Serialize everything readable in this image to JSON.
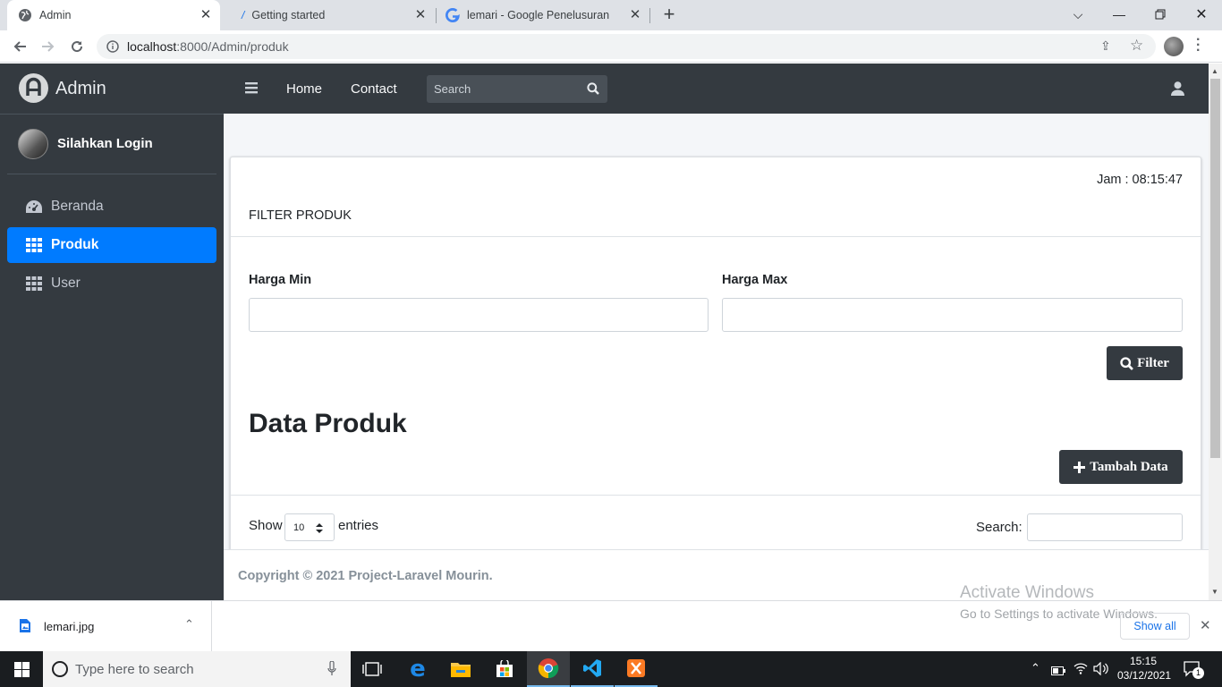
{
  "browser": {
    "tabs": [
      {
        "title": "Admin"
      },
      {
        "title": "Getting started"
      },
      {
        "title": "lemari - Google Penelusuran"
      }
    ],
    "url_host": "localhost",
    "url_rest": ":8000/Admin/produk"
  },
  "sidebar": {
    "brand": "Admin",
    "user": "Silahkan Login",
    "items": [
      {
        "label": "Beranda",
        "icon": "dashboard-icon"
      },
      {
        "label": "Produk",
        "icon": "grid-icon",
        "active": true
      },
      {
        "label": "User",
        "icon": "grid-icon"
      }
    ]
  },
  "navbar": {
    "links": [
      "Home",
      "Contact"
    ],
    "search_placeholder": "Search"
  },
  "main": {
    "clock": "Jam : 08:15:47",
    "filter_title": "FILTER PRODUK",
    "harga_min_label": "Harga Min",
    "harga_max_label": "Harga Max",
    "filter_button": "Filter",
    "heading": "Data Produk",
    "add_button": "Tambah Data",
    "show_label": "Show",
    "entries_value": "10",
    "entries_label": "entries",
    "search_label": "Search:"
  },
  "footer": {
    "copyright": "Copyright © 2021 Project-Laravel Mourin."
  },
  "watermark": {
    "line1": "Activate Windows",
    "line2": "Go to Settings to activate Windows."
  },
  "downloads": {
    "file": "lemari.jpg",
    "show_all": "Show all"
  },
  "taskbar": {
    "search_placeholder": "Type here to search",
    "time": "15:15",
    "date": "03/12/2021",
    "notifications": "1"
  },
  "colors": {
    "sidebar_bg": "#343a40",
    "active_item": "#007bff",
    "content_bg": "#f4f6f9"
  }
}
